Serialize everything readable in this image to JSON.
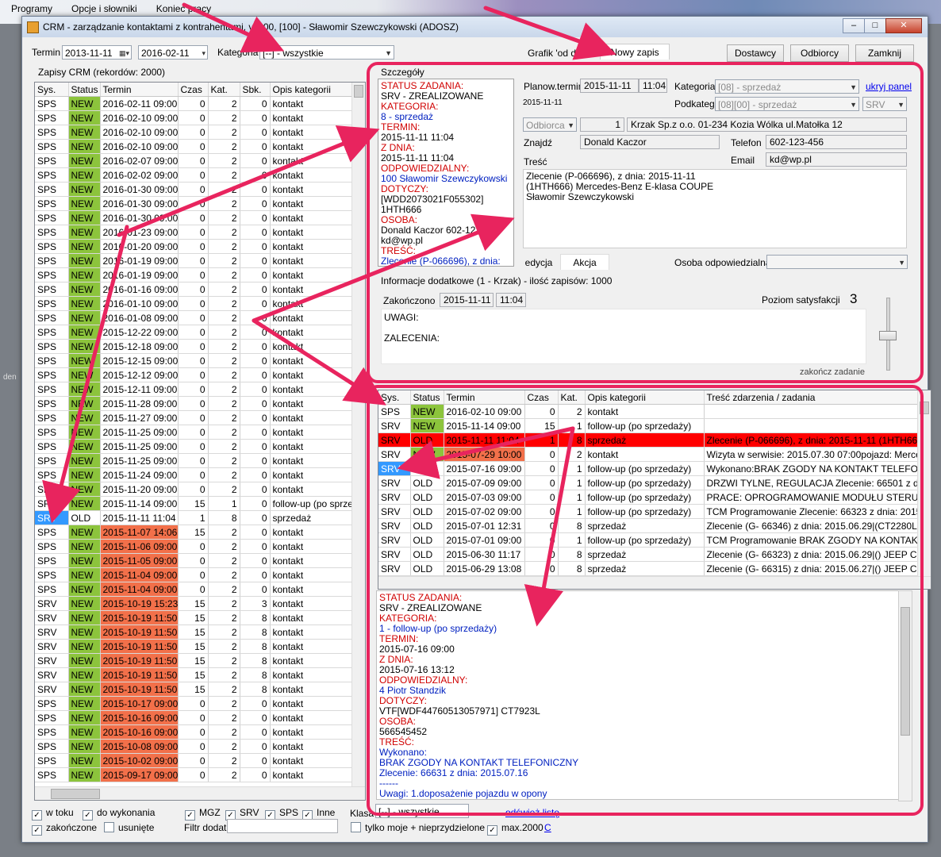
{
  "desktop_menu": [
    "Programy",
    "Opcje i słowniki",
    "Koniec pracy"
  ],
  "desktop_side_text": "den",
  "window": {
    "title": "CRM - zarządzanie kontaktami z kontrahentami, v.1.00,  [100] - Sławomir Szewczykowski (ADOSZ)"
  },
  "filter": {
    "termin_label": "Termin",
    "date_from": "2013-11-11",
    "date_to": "2016-02-11",
    "kategoria_label": "Kategoria",
    "kategoria_value": "[--] - wszystkie"
  },
  "tabs": [
    "Grafik 'od dziś'",
    "Nowy zapis"
  ],
  "buttons": {
    "dostawcy": "Dostawcy",
    "odbiorcy": "Odbiorcy",
    "zamknij": "Zamknij"
  },
  "left_panel": {
    "title": "Zapisy CRM   (rekordów: 2000)",
    "columns": [
      "Sys.",
      "Status",
      "Termin",
      "Czas",
      "Kat.",
      "Sbk.",
      "Opis kategorii"
    ],
    "rows": [
      [
        "SPS",
        "NEW",
        "2016-02-11 09:00",
        "0",
        "2",
        "0",
        "kontakt"
      ],
      [
        "SPS",
        "NEW",
        "2016-02-10 09:00",
        "0",
        "2",
        "0",
        "kontakt"
      ],
      [
        "SPS",
        "NEW",
        "2016-02-10 09:00",
        "0",
        "2",
        "0",
        "kontakt"
      ],
      [
        "SPS",
        "NEW",
        "2016-02-10 09:00",
        "0",
        "2",
        "0",
        "kontakt"
      ],
      [
        "SPS",
        "NEW",
        "2016-02-07 09:00",
        "0",
        "2",
        "0",
        "kontakt"
      ],
      [
        "SPS",
        "NEW",
        "2016-02-02 09:00",
        "0",
        "2",
        "0",
        "kontakt"
      ],
      [
        "SPS",
        "NEW",
        "2016-01-30 09:00",
        "0",
        "2",
        "0",
        "kontakt"
      ],
      [
        "SPS",
        "NEW",
        "2016-01-30 09:00",
        "0",
        "2",
        "0",
        "kontakt"
      ],
      [
        "SPS",
        "NEW",
        "2016-01-30 09:00",
        "0",
        "2",
        "0",
        "kontakt"
      ],
      [
        "SPS",
        "NEW",
        "2016-01-23 09:00",
        "0",
        "2",
        "0",
        "kontakt"
      ],
      [
        "SPS",
        "NEW",
        "2016-01-20 09:00",
        "0",
        "2",
        "0",
        "kontakt"
      ],
      [
        "SPS",
        "NEW",
        "2016-01-19 09:00",
        "0",
        "2",
        "0",
        "kontakt"
      ],
      [
        "SPS",
        "NEW",
        "2016-01-19 09:00",
        "0",
        "2",
        "0",
        "kontakt"
      ],
      [
        "SPS",
        "NEW",
        "2016-01-16 09:00",
        "0",
        "2",
        "0",
        "kontakt"
      ],
      [
        "SPS",
        "NEW",
        "2016-01-10 09:00",
        "0",
        "2",
        "0",
        "kontakt"
      ],
      [
        "SPS",
        "NEW",
        "2016-01-08 09:00",
        "0",
        "2",
        "0",
        "kontakt"
      ],
      [
        "SPS",
        "NEW",
        "2015-12-22 09:00",
        "0",
        "2",
        "0",
        "kontakt"
      ],
      [
        "SPS",
        "NEW",
        "2015-12-18 09:00",
        "0",
        "2",
        "0",
        "kontakt"
      ],
      [
        "SPS",
        "NEW",
        "2015-12-15 09:00",
        "0",
        "2",
        "0",
        "kontakt"
      ],
      [
        "SPS",
        "NEW",
        "2015-12-12 09:00",
        "0",
        "2",
        "0",
        "kontakt"
      ],
      [
        "SPS",
        "NEW",
        "2015-12-11 09:00",
        "0",
        "2",
        "0",
        "kontakt"
      ],
      [
        "SPS",
        "NEW",
        "2015-11-28 09:00",
        "0",
        "2",
        "0",
        "kontakt"
      ],
      [
        "SPS",
        "NEW",
        "2015-11-27 09:00",
        "0",
        "2",
        "0",
        "kontakt"
      ],
      [
        "SPS",
        "NEW",
        "2015-11-25 09:00",
        "0",
        "2",
        "0",
        "kontakt"
      ],
      [
        "SPS",
        "NEW",
        "2015-11-25 09:00",
        "0",
        "2",
        "0",
        "kontakt"
      ],
      [
        "SPS",
        "NEW",
        "2015-11-25 09:00",
        "0",
        "2",
        "0",
        "kontakt"
      ],
      [
        "SPS",
        "NEW",
        "2015-11-24 09:00",
        "0",
        "2",
        "0",
        "kontakt"
      ],
      [
        "SPS",
        "NEW",
        "2015-11-20 09:00",
        "0",
        "2",
        "0",
        "kontakt"
      ],
      [
        "SRV",
        "NEW",
        "2015-11-14 09:00",
        "15",
        "1",
        "0",
        "follow-up (po sprzed"
      ],
      [
        "SRV",
        "OLD",
        "2015-11-11 11:04",
        "1",
        "8",
        "0",
        "sprzedaż"
      ],
      [
        "SPS",
        "NEW",
        "2015-11-07 14:06",
        "15",
        "2",
        "0",
        "kontakt"
      ],
      [
        "SPS",
        "NEW",
        "2015-11-06 09:00",
        "0",
        "2",
        "0",
        "kontakt"
      ],
      [
        "SPS",
        "NEW",
        "2015-11-05 09:00",
        "0",
        "2",
        "0",
        "kontakt"
      ],
      [
        "SPS",
        "NEW",
        "2015-11-04 09:00",
        "0",
        "2",
        "0",
        "kontakt"
      ],
      [
        "SPS",
        "NEW",
        "2015-11-04 09:00",
        "0",
        "2",
        "0",
        "kontakt"
      ],
      [
        "SRV",
        "NEW",
        "2015-10-19 15:23",
        "15",
        "2",
        "3",
        "kontakt"
      ],
      [
        "SRV",
        "NEW",
        "2015-10-19 11:50",
        "15",
        "2",
        "8",
        "kontakt"
      ],
      [
        "SRV",
        "NEW",
        "2015-10-19 11:50",
        "15",
        "2",
        "8",
        "kontakt"
      ],
      [
        "SRV",
        "NEW",
        "2015-10-19 11:50",
        "15",
        "2",
        "8",
        "kontakt"
      ],
      [
        "SRV",
        "NEW",
        "2015-10-19 11:50",
        "15",
        "2",
        "8",
        "kontakt"
      ],
      [
        "SRV",
        "NEW",
        "2015-10-19 11:50",
        "15",
        "2",
        "8",
        "kontakt"
      ],
      [
        "SRV",
        "NEW",
        "2015-10-19 11:50",
        "15",
        "2",
        "8",
        "kontakt"
      ],
      [
        "SPS",
        "NEW",
        "2015-10-17 09:00",
        "0",
        "2",
        "0",
        "kontakt"
      ],
      [
        "SPS",
        "NEW",
        "2015-10-16 09:00",
        "0",
        "2",
        "0",
        "kontakt"
      ],
      [
        "SPS",
        "NEW",
        "2015-10-16 09:00",
        "0",
        "2",
        "0",
        "kontakt"
      ],
      [
        "SPS",
        "NEW",
        "2015-10-08 09:00",
        "0",
        "2",
        "0",
        "kontakt"
      ],
      [
        "SPS",
        "NEW",
        "2015-10-02 09:00",
        "0",
        "2",
        "0",
        "kontakt"
      ],
      [
        "SPS",
        "NEW",
        "2015-09-17 09:00",
        "0",
        "2",
        "0",
        "kontakt"
      ]
    ]
  },
  "details": {
    "title": "Szczegóły",
    "summary": [
      {
        "t": "STATUS ZADANIA:",
        "c": "red"
      },
      {
        "t": "SRV - ZREALIZOWANE",
        "c": ""
      },
      {
        "t": "KATEGORIA:",
        "c": "red"
      },
      {
        "t": "8 - sprzedaż",
        "c": "blue"
      },
      {
        "t": "TERMIN:",
        "c": "red"
      },
      {
        "t": "2015-11-11 11:04",
        "c": ""
      },
      {
        "t": "Z DNIA:",
        "c": "red"
      },
      {
        "t": "2015-11-11 11:04",
        "c": ""
      },
      {
        "t": "ODPOWIEDZIALNY:",
        "c": "red"
      },
      {
        "t": "100 Sławomir Szewczykowski",
        "c": "blue"
      },
      {
        "t": "DOTYCZY:",
        "c": "red"
      },
      {
        "t": "[WDD2073021F055302]",
        "c": ""
      },
      {
        "t": "1HTH666",
        "c": ""
      },
      {
        "t": "OSOBA:",
        "c": "red"
      },
      {
        "t": "Donald Kaczor 602-123-456",
        "c": ""
      },
      {
        "t": "kd@wp.pl",
        "c": ""
      },
      {
        "t": "TREŚĆ:",
        "c": "red"
      },
      {
        "t": "Zlecenie (P-066696), z dnia:",
        "c": "blue"
      }
    ],
    "planow_label": "Planow.termin",
    "planow_date": "2015-11-11",
    "planow_time": "11:04",
    "small_date": "2015-11-11",
    "kategoria_label": "Kategoria",
    "kategoria_value": "[08] - sprzedaż",
    "podkateg_label": "Podkateg.",
    "podkateg_value": "[08][00] - sprzedaż",
    "srv_value": "SRV",
    "ukryj_link": "ukryj panel",
    "odbiorca_value": "Odbiorca",
    "odbiorca_num": "1",
    "odbiorca_address": "Krzak Sp.z o.o.  01-234 Kozia Wólka ul.Matołka 12",
    "znajdz_label": "Znajdź",
    "znajdz_value": "Donald Kaczor",
    "telefon_label": "Telefon",
    "telefon_value": "602-123-456",
    "email_label": "Email",
    "email_value": "kd@wp.pl",
    "tresc_label": "Treść",
    "tresc_lines": [
      "Zlecenie (P-066696), z dnia: 2015-11-11",
      "(1HTH666) Mercedes-Benz E-klasa COUPE",
      "Sławomir Szewczykowski"
    ],
    "subtabs": [
      "edycja",
      "Akcja"
    ],
    "osoba_label": "Osoba odpowiedzialna",
    "info_title": "Informacje dodatkowe (1 - Krzak) - ilość zapisów: 1000",
    "zakonczono_label": "Zakończono",
    "zakonczono_date": "2015-11-11",
    "zakonczono_time": "11:04",
    "poziom_label": "Poziom satysfakcji",
    "poziom_value": "3",
    "uwagi_label": "UWAGI:",
    "zalecenia_label": "ZALECENIA:",
    "zakoncz_label": "zakończ zadanie"
  },
  "history": {
    "columns": [
      "Sys.",
      "Status",
      "Termin",
      "Czas",
      "Kat.",
      "Opis kategorii",
      "Treść zdarzenia / zadania"
    ],
    "rows": [
      [
        "SPS",
        "NEW",
        "2016-02-10 09:00",
        "0",
        "2",
        "kontakt",
        ""
      ],
      [
        "SRV",
        "NEW",
        "2015-11-14 09:00",
        "15",
        "1",
        "follow-up (po sprzedaży)",
        ""
      ],
      [
        "SRV",
        "OLD",
        "2015-11-11 11:04",
        "1",
        "8",
        "sprzedaż",
        "Zlecenie (P-066696), z dnia: 2015-11-11 (1HTH666"
      ],
      [
        "SRV",
        "NEW",
        "2015-07-29 10:00",
        "0",
        "2",
        "kontakt",
        "Wizyta w serwisie: 2015.07.30  07:00pojazd: Merce"
      ],
      [
        "SRV",
        "OLD",
        "2015-07-16 09:00",
        "0",
        "1",
        "follow-up (po sprzedaży)",
        "Wykonano:BRAK ZGODY NA KONTAKT TELEFO"
      ],
      [
        "SRV",
        "OLD",
        "2015-07-09 09:00",
        "0",
        "1",
        "follow-up (po sprzedaży)",
        "DRZWI TYLNE, REGULACJA Zlecenie: 66501  z d"
      ],
      [
        "SRV",
        "OLD",
        "2015-07-03 09:00",
        "0",
        "1",
        "follow-up (po sprzedaży)",
        "PRACE: OPROGRAMOWANIE MODUŁU STERU"
      ],
      [
        "SRV",
        "OLD",
        "2015-07-02 09:00",
        "0",
        "1",
        "follow-up (po sprzedaży)",
        "TCM Programowanie Zlecenie: 66323  z dnia: 2015"
      ],
      [
        "SRV",
        "OLD",
        "2015-07-01 12:31",
        "0",
        "8",
        "sprzedaż",
        "Zlecenie (G- 66346) z dnia: 2015.06.29|(CT2280L)"
      ],
      [
        "SRV",
        "OLD",
        "2015-07-01 09:00",
        "0",
        "1",
        "follow-up (po sprzedaży)",
        "TCM Programowanie BRAK ZGODY NA KONTAKT"
      ],
      [
        "SRV",
        "OLD",
        "2015-06-30 11:17",
        "0",
        "8",
        "sprzedaż",
        "Zlecenie (G- 66323) z dnia: 2015.06.29|() JEEP CH"
      ],
      [
        "SRV",
        "OLD",
        "2015-06-29 13:08",
        "0",
        "8",
        "sprzedaż",
        "Zlecenie (G- 66315) z dnia: 2015.06.27|() JEEP CH"
      ]
    ]
  },
  "bottom_detail": [
    {
      "t": "STATUS ZADANIA:",
      "c": "red"
    },
    {
      "t": "SRV - ZREALIZOWANE",
      "c": ""
    },
    {
      "t": "KATEGORIA:",
      "c": "red"
    },
    {
      "t": "1 - follow-up (po sprzedaży)",
      "c": "blue"
    },
    {
      "t": "TERMIN:",
      "c": "red"
    },
    {
      "t": "2015-07-16 09:00",
      "c": ""
    },
    {
      "t": "Z DNIA:",
      "c": "red"
    },
    {
      "t": "2015-07-16 13:12",
      "c": ""
    },
    {
      "t": "ODPOWIEDZIALNY:",
      "c": "red"
    },
    {
      "t": "4 Piotr Standzik",
      "c": "blue"
    },
    {
      "t": "DOTYCZY:",
      "c": "red"
    },
    {
      "t": "VTF[WDF44760513057971] CT7923L",
      "c": ""
    },
    {
      "t": "OSOBA:",
      "c": "red"
    },
    {
      "t": " 566545452",
      "c": ""
    },
    {
      "t": "TREŚĆ:",
      "c": "red"
    },
    {
      "t": "Wykonano:",
      "c": "blue"
    },
    {
      "t": "BRAK ZGODY NA KONTAKT TELEFONICZNY",
      "c": "blue"
    },
    {
      "t": "Zlecenie: 66631  z dnia: 2015.07.16",
      "c": "blue"
    },
    {
      "t": "------",
      "c": "blue"
    },
    {
      "t": "Uwagi: 1.doposażenie pojazdu w opony",
      "c": "blue"
    }
  ],
  "footer": {
    "w_toku": "w toku",
    "do_wykonania": "do wykonania",
    "mgz": "MGZ",
    "srv": "SRV",
    "sps": "SPS",
    "inne": "Inne",
    "klasa_label": "Klasa",
    "klasa_value": "[--] - wszystkie",
    "odswiez": "odśwież listę",
    "zakonczone": "zakończone",
    "usuniete": "usunięte",
    "filtr_label": "Filtr dodat.",
    "tylko_moje": "tylko moje + nieprzydzielone",
    "max": "max.2000",
    "c_link": "C"
  },
  "colors": {
    "new_green": "#8cc43c",
    "due_red": "#f2704a",
    "selected_blue": "#3399ff",
    "active_row_red": "#ff0000",
    "highlight_pink": "#e8245e"
  }
}
